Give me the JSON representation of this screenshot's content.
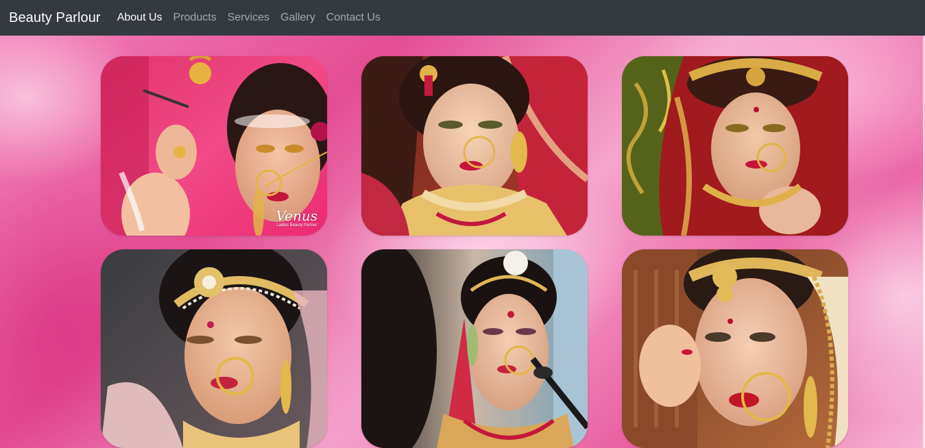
{
  "navbar": {
    "brand": "Beauty Parlour",
    "links": [
      {
        "label": "About Us",
        "active": true
      },
      {
        "label": "Products",
        "active": false
      },
      {
        "label": "Services",
        "active": false
      },
      {
        "label": "Gallery",
        "active": false
      },
      {
        "label": "Contact Us",
        "active": false
      }
    ]
  },
  "colors": {
    "navbar_bg": "#343a40",
    "brand_text": "#ffffff",
    "nav_link_active": "#ffffff",
    "nav_link_inactive": "rgba(255,255,255,0.55)",
    "background_pink": "#e56aa6"
  },
  "gallery": {
    "images": [
      {
        "subject": "bridal-makeup-photo",
        "watermark": {
          "main": "Venus",
          "sub": "Ladies Beauty Parlour"
        }
      },
      {
        "subject": "bridal-makeup-photo"
      },
      {
        "subject": "bridal-makeup-photo"
      },
      {
        "subject": "bridal-makeup-photo"
      },
      {
        "subject": "bridal-makeup-photo"
      },
      {
        "subject": "bridal-makeup-photo"
      }
    ]
  }
}
